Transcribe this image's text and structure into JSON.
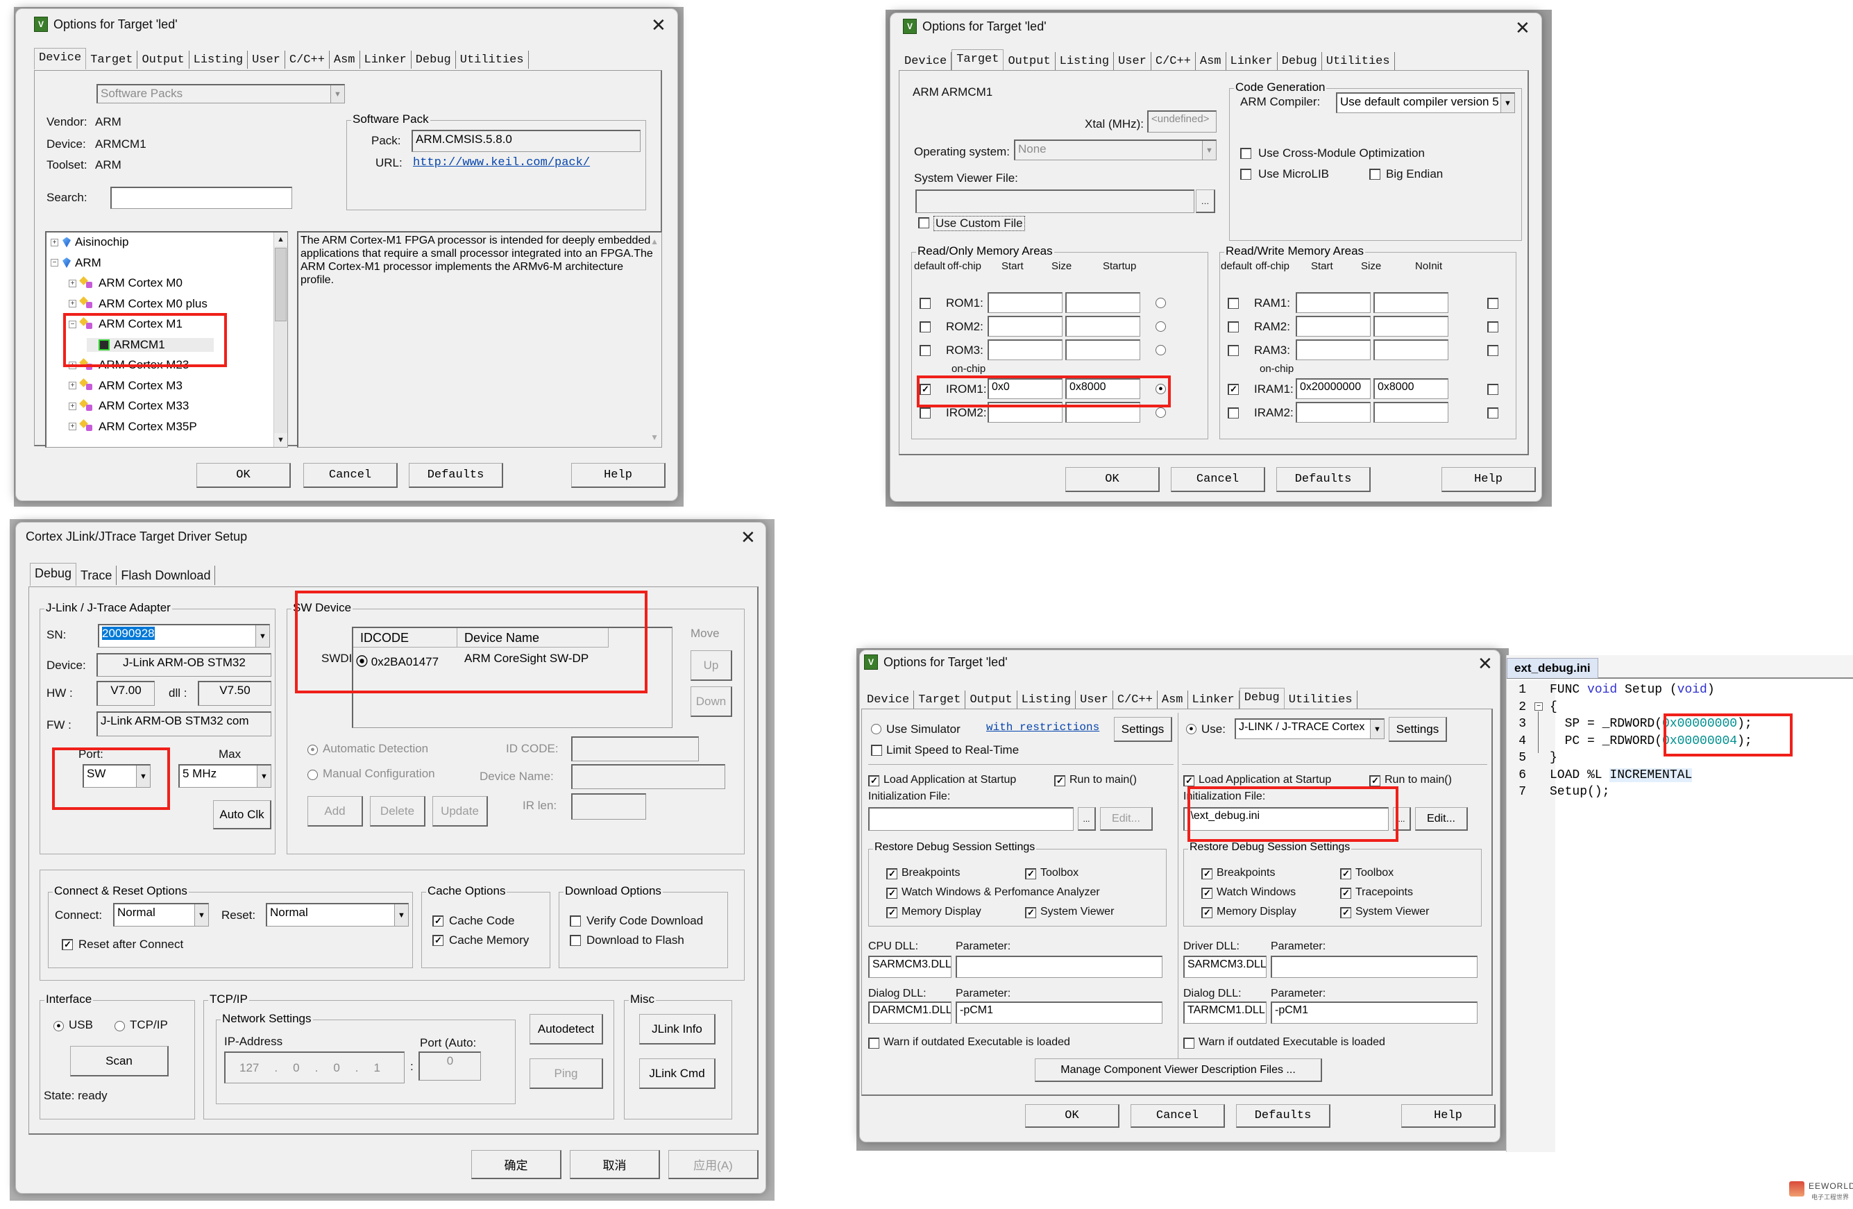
{
  "device_dialog": {
    "title": "Options for Target 'led'",
    "tabs": [
      "Device",
      "Target",
      "Output",
      "Listing",
      "User",
      "C/C++",
      "Asm",
      "Linker",
      "Debug",
      "Utilities"
    ],
    "active_tab": "Device",
    "software_packs_select": "Software Packs",
    "vendor_label": "Vendor:",
    "vendor": "ARM",
    "device_label": "Device:",
    "device": "ARMCM1",
    "toolset_label": "Toolset:",
    "toolset": "ARM",
    "search_label": "Search:",
    "search_value": "",
    "software_pack_group": "Software Pack",
    "pack_label": "Pack:",
    "pack": "ARM.CMSIS.5.8.0",
    "url_label": "URL:",
    "url": "http://www.keil.com/pack/",
    "tree": [
      {
        "label": "Aisinochip",
        "level": 0,
        "expander": "+",
        "icon": "vendor-gem-icon"
      },
      {
        "label": "ARM",
        "level": 0,
        "expander": "-",
        "icon": "vendor-gem-icon"
      },
      {
        "label": "ARM Cortex M0",
        "level": 1,
        "expander": "+",
        "icon": "mcu-family-icon"
      },
      {
        "label": "ARM Cortex M0 plus",
        "level": 1,
        "expander": "+",
        "icon": "mcu-family-icon"
      },
      {
        "label": "ARM Cortex M1",
        "level": 1,
        "expander": "-",
        "icon": "mcu-family-icon"
      },
      {
        "label": "ARMCM1",
        "level": 2,
        "expander": "",
        "icon": "chip-icon",
        "selected": true
      },
      {
        "label": "ARM Cortex M23",
        "level": 1,
        "expander": "+",
        "icon": "mcu-family-icon"
      },
      {
        "label": "ARM Cortex M3",
        "level": 1,
        "expander": "+",
        "icon": "mcu-family-icon"
      },
      {
        "label": "ARM Cortex M33",
        "level": 1,
        "expander": "+",
        "icon": "mcu-family-icon"
      },
      {
        "label": "ARM Cortex M35P",
        "level": 1,
        "expander": "+",
        "icon": "mcu-family-icon"
      }
    ],
    "description": "The ARM Cortex-M1 FPGA processor is intended for deeply embedded applications that require a small processor integrated into an FPGA.The ARM Cortex-M1 processor implements the ARMv6-M architecture profile.",
    "buttons": {
      "ok": "OK",
      "cancel": "Cancel",
      "defaults": "Defaults",
      "help": "Help"
    }
  },
  "target_dialog": {
    "title": "Options for Target 'led'",
    "tabs": [
      "Device",
      "Target",
      "Output",
      "Listing",
      "User",
      "C/C++",
      "Asm",
      "Linker",
      "Debug",
      "Utilities"
    ],
    "active_tab": "Target",
    "device_name": "ARM ARMCM1",
    "xtal_label": "Xtal (MHz):",
    "xtal_value": "<undefined>",
    "os_label": "Operating system:",
    "os_value": "None",
    "svf_label": "System Viewer File:",
    "svf_value": "",
    "use_custom_file": {
      "label": "Use Custom File",
      "checked": false
    },
    "code_gen_group": "Code Generation",
    "compiler_label": "ARM Compiler:",
    "compiler_value": "Use default compiler version 5",
    "cross_module": {
      "label": "Use Cross-Module Optimization",
      "checked": false
    },
    "microlib": {
      "label": "Use MicroLIB",
      "checked": false
    },
    "big_endian": {
      "label": "Big Endian",
      "checked": false
    },
    "ro_group": "Read/Only Memory Areas",
    "rw_group": "Read/Write Memory Areas",
    "ro_headers": [
      "default",
      "off-chip",
      "Start",
      "Size",
      "Startup"
    ],
    "rw_headers": [
      "default",
      "off-chip",
      "Start",
      "Size",
      "NoInit"
    ],
    "on_chip_label": "on-chip",
    "rom_rows": [
      {
        "name": "ROM1:",
        "default": false,
        "start": "",
        "size": "",
        "startup": false
      },
      {
        "name": "ROM2:",
        "default": false,
        "start": "",
        "size": "",
        "startup": false
      },
      {
        "name": "ROM3:",
        "default": false,
        "start": "",
        "size": "",
        "startup": false
      },
      {
        "name": "IROM1:",
        "default": true,
        "start": "0x0",
        "size": "0x8000",
        "startup": true
      },
      {
        "name": "IROM2:",
        "default": false,
        "start": "",
        "size": "",
        "startup": false
      }
    ],
    "ram_rows": [
      {
        "name": "RAM1:",
        "default": false,
        "start": "",
        "size": "",
        "noinit": false
      },
      {
        "name": "RAM2:",
        "default": false,
        "start": "",
        "size": "",
        "noinit": false
      },
      {
        "name": "RAM3:",
        "default": false,
        "start": "",
        "size": "",
        "noinit": false
      },
      {
        "name": "IRAM1:",
        "default": true,
        "start": "0x20000000",
        "size": "0x8000",
        "noinit": false
      },
      {
        "name": "IRAM2:",
        "default": false,
        "start": "",
        "size": "",
        "noinit": false
      }
    ],
    "buttons": {
      "ok": "OK",
      "cancel": "Cancel",
      "defaults": "Defaults",
      "help": "Help"
    }
  },
  "jlink_dialog": {
    "title": "Cortex JLink/JTrace Target Driver Setup",
    "tabs": [
      "Debug",
      "Trace",
      "Flash Download"
    ],
    "active_tab": "Debug",
    "adapter_group": "J-Link / J-Trace Adapter",
    "sn_label": "SN:",
    "sn_value": "20090928",
    "device_label": "Device:",
    "device_value": "J-Link ARM-OB STM32",
    "hw_label": "HW :",
    "hw_value": "V7.00",
    "dll_label": "dll :",
    "dll_value": "V7.50",
    "fw_label": "FW :",
    "fw_value": "J-Link ARM-OB STM32 com",
    "port_label": "Port:",
    "port_value": "SW",
    "max_label": "Max",
    "max_value": "5 MHz",
    "auto_clk": "Auto Clk",
    "sw_device_group": "SW Device",
    "swd_label": "SWDI",
    "sw_headers": [
      "IDCODE",
      "Device Name"
    ],
    "sw_rows": [
      {
        "idcode": "0x2BA01477",
        "name": "ARM CoreSight SW-DP"
      }
    ],
    "move_label": "Move",
    "up": "Up",
    "down": "Down",
    "auto_detect": {
      "label": "Automatic Detection",
      "selected": true
    },
    "manual_config": {
      "label": "Manual Configuration",
      "selected": false
    },
    "id_code_label": "ID CODE:",
    "device_name_label": "Device Name:",
    "ir_len_label": "IR len:",
    "add": "Add",
    "delete": "Delete",
    "update": "Update",
    "connect_group": "Connect & Reset Options",
    "connect_label": "Connect:",
    "connect_value": "Normal",
    "reset_label": "Reset:",
    "reset_value": "Normal",
    "reset_after_connect": {
      "label": "Reset after Connect",
      "checked": true
    },
    "cache_group": "Cache Options",
    "cache_code": {
      "label": "Cache Code",
      "checked": true
    },
    "cache_memory": {
      "label": "Cache Memory",
      "checked": true
    },
    "download_group": "Download Options",
    "verify_code": {
      "label": "Verify Code Download",
      "checked": false
    },
    "download_flash": {
      "label": "Download to Flash",
      "checked": false
    },
    "interface_group": "Interface",
    "usb": {
      "label": "USB",
      "selected": true
    },
    "tcpip": {
      "label": "TCP/IP",
      "selected": false
    },
    "scan": "Scan",
    "state": "State: ready",
    "tcpip_group": "TCP/IP",
    "network_group": "Network Settings",
    "ip_label": "IP-Address",
    "ip_value": [
      "127",
      "0",
      "0",
      "1"
    ],
    "port_auto_label": "Port (Auto:",
    "port_auto_value": "0",
    "autodetect": "Autodetect",
    "ping": "Ping",
    "misc_group": "Misc",
    "jlink_info": "JLink Info",
    "jlink_cmd": "JLink Cmd",
    "buttons": {
      "ok": "确定",
      "cancel": "取消",
      "apply": "应用(A)"
    }
  },
  "debug_dialog": {
    "title": "Options for Target 'led'",
    "tabs": [
      "Device",
      "Target",
      "Output",
      "Listing",
      "User",
      "C/C++",
      "Asm",
      "Linker",
      "Debug",
      "Utilities"
    ],
    "active_tab": "Debug",
    "use_simulator": {
      "label": "Use Simulator",
      "selected": false
    },
    "with_restrictions": "with restrictions",
    "settings": "Settings",
    "limit_speed": {
      "label": "Limit Speed to Real-Time",
      "checked": false
    },
    "use_label": "Use:",
    "use_value": "J-LINK / J-TRACE Cortex",
    "use_selected": true,
    "left": {
      "load_app": {
        "label": "Load Application at Startup",
        "checked": true
      },
      "run_main": {
        "label": "Run to main()",
        "checked": true
      },
      "init_label": "Initialization File:",
      "init_value": "",
      "browse": "...",
      "edit": "Edit...",
      "restore_group": "Restore Debug Session Settings",
      "restore": [
        {
          "label": "Breakpoints",
          "checked": true
        },
        {
          "label": "Toolbox",
          "checked": true
        },
        {
          "label": "Watch Windows & Perfomance Analyzer",
          "checked": true
        },
        {
          "label": "Memory Display",
          "checked": true
        },
        {
          "label": "System Viewer",
          "checked": true
        }
      ],
      "dll1_label": "CPU DLL:",
      "dll1_value": "SARMCM3.DLL",
      "param_label": "Parameter:",
      "param1_value": "",
      "dll2_label": "Dialog DLL:",
      "dll2_value": "DARMCM1.DLL",
      "param2_value": "-pCM1",
      "warn": {
        "label": "Warn if outdated Executable is loaded",
        "checked": false
      }
    },
    "right": {
      "load_app": {
        "label": "Load Application at Startup",
        "checked": true
      },
      "run_main": {
        "label": "Run to main()",
        "checked": true
      },
      "init_label": "Initialization File:",
      "init_value": ".\\ext_debug.ini",
      "browse": "...",
      "edit": "Edit...",
      "restore_group": "Restore Debug Session Settings",
      "restore": [
        {
          "label": "Breakpoints",
          "checked": true
        },
        {
          "label": "Toolbox",
          "checked": true
        },
        {
          "label": "Watch Windows",
          "checked": true
        },
        {
          "label": "Tracepoints",
          "checked": true
        },
        {
          "label": "Memory Display",
          "checked": true
        },
        {
          "label": "System Viewer",
          "checked": true
        }
      ],
      "dll1_label": "Driver DLL:",
      "dll1_value": "SARMCM3.DLL",
      "param_label": "Parameter:",
      "param1_value": "",
      "dll2_label": "Dialog DLL:",
      "dll2_value": "TARMCM1.DLL",
      "param2_value": "-pCM1",
      "warn": {
        "label": "Warn if outdated Executable is loaded",
        "checked": false
      }
    },
    "manage_component": "Manage Component Viewer Description Files ...",
    "buttons": {
      "ok": "OK",
      "cancel": "Cancel",
      "defaults": "Defaults",
      "help": "Help"
    }
  },
  "editor": {
    "tab": "ext_debug.ini",
    "lines": [
      {
        "n": "1",
        "text": "FUNC void Setup (void)"
      },
      {
        "n": "2",
        "text": "{"
      },
      {
        "n": "3",
        "text": "  SP = _RDWORD(0x00000000);"
      },
      {
        "n": "4",
        "text": "  PC = _RDWORD(0x00000004);"
      },
      {
        "n": "5",
        "text": "}"
      },
      {
        "n": "6",
        "text": "LOAD %L INCREMENTAL"
      },
      {
        "n": "7",
        "text": "Setup();"
      }
    ]
  },
  "watermark": {
    "brand": "EEWORLD",
    "sub": "电子工程世界"
  },
  "colors": {
    "highlight_box": "#f0201a",
    "selection": "#0078d7",
    "link": "#0645ad",
    "keyword": "#3030d0",
    "number": "#008f8f"
  }
}
